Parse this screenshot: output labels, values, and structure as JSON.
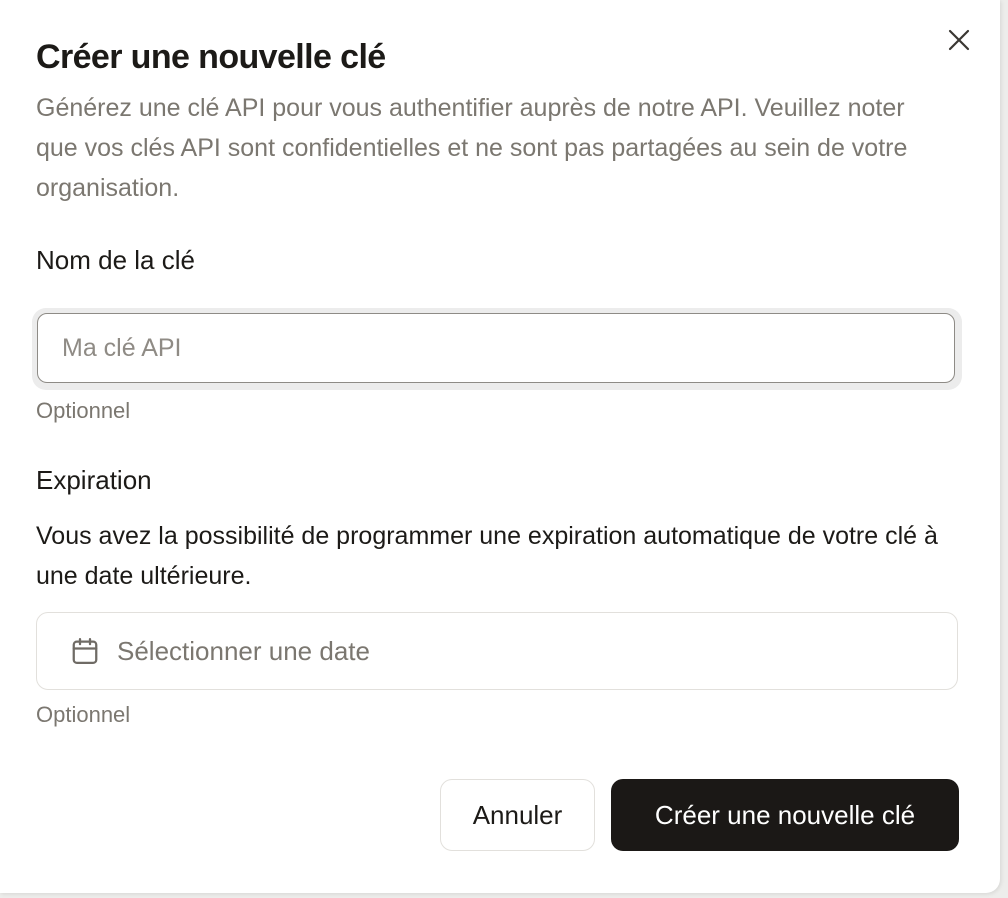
{
  "dialog": {
    "title": "Créer une nouvelle clé",
    "description": "Générez une clé API pour vous authentifier auprès de notre API. Veuillez noter que vos clés API sont confidentielles et ne sont pas partagées au sein de votre organisation.",
    "close_icon": "close-icon"
  },
  "key_name": {
    "label": "Nom de la clé",
    "value": "",
    "placeholder": "Ma clé API",
    "hint": "Optionnel"
  },
  "expiration": {
    "label": "Expiration",
    "description": "Vous avez la possibilité de programmer une expiration automatique de votre clé à une date ultérieure.",
    "date_placeholder": "Sélectionner une date",
    "date_icon": "calendar-icon",
    "hint": "Optionnel"
  },
  "actions": {
    "cancel_label": "Annuler",
    "create_label": "Créer une nouvelle clé"
  },
  "colors": {
    "primary_button": "#1b1816",
    "muted_text": "#7b7770",
    "text": "#1c1a17"
  }
}
